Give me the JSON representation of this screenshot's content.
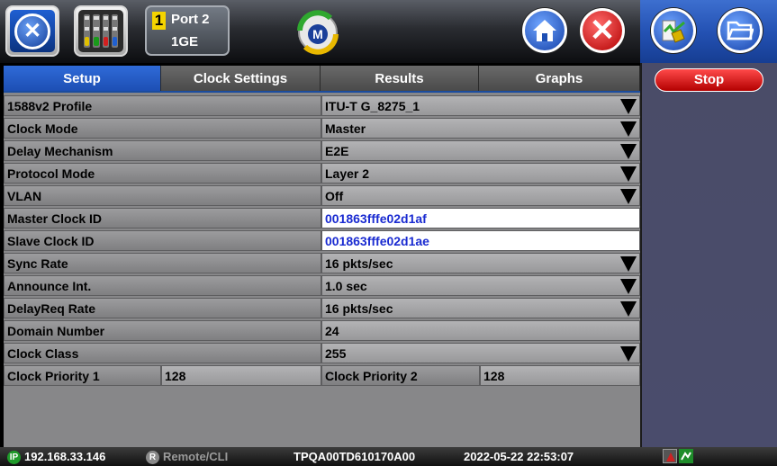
{
  "header": {
    "port": {
      "number": "1",
      "label": "Port 2",
      "speed": "1GE"
    },
    "mode_icon_letter": "M",
    "icons": [
      "tools-icon",
      "module-icon",
      "mode-icon",
      "home-icon",
      "close-icon",
      "dashboard-icon",
      "folder-icon"
    ]
  },
  "tabs": [
    {
      "label": "Setup",
      "active": true
    },
    {
      "label": "Clock Settings",
      "active": false
    },
    {
      "label": "Results",
      "active": false
    },
    {
      "label": "Graphs",
      "active": false
    }
  ],
  "settings": {
    "profile": {
      "label": "1588v2 Profile",
      "value": "ITU-T G_8275_1"
    },
    "clock_mode": {
      "label": "Clock Mode",
      "value": "Master"
    },
    "delay_mechanism": {
      "label": "Delay Mechanism",
      "value": "E2E"
    },
    "protocol_mode": {
      "label": "Protocol Mode",
      "value": "Layer 2"
    },
    "vlan": {
      "label": "VLAN",
      "value": "Off"
    },
    "master_clock_id": {
      "label": "Master Clock ID",
      "value": "001863fffe02d1af"
    },
    "slave_clock_id": {
      "label": "Slave Clock ID",
      "value": "001863fffe02d1ae"
    },
    "sync_rate": {
      "label": "Sync Rate",
      "value": "16 pkts/sec"
    },
    "announce_int": {
      "label": "Announce Int.",
      "value": "1.0 sec"
    },
    "delayreq_rate": {
      "label": "DelayReq Rate",
      "value": "16 pkts/sec"
    },
    "domain_number": {
      "label": "Domain Number",
      "value": "24"
    },
    "clock_class": {
      "label": "Clock Class",
      "value": "255"
    },
    "clock_priority_1": {
      "label": "Clock Priority 1",
      "value": "128"
    },
    "clock_priority_2": {
      "label": "Clock Priority 2",
      "value": "128"
    }
  },
  "right_panel": {
    "stop_label": "Stop"
  },
  "status": {
    "ip_badge": "IP",
    "ip": "192.168.33.146",
    "remote_badge": "R",
    "remote": "Remote/CLI",
    "serial": "TPQA00TD610170A00",
    "datetime": "2022-05-22 22:53:07"
  },
  "colors": {
    "active_tab": "#1d4fb4",
    "stop_button": "#d10000",
    "editable_text": "#1a2bd1",
    "right_panel": "#4a4c6a"
  }
}
